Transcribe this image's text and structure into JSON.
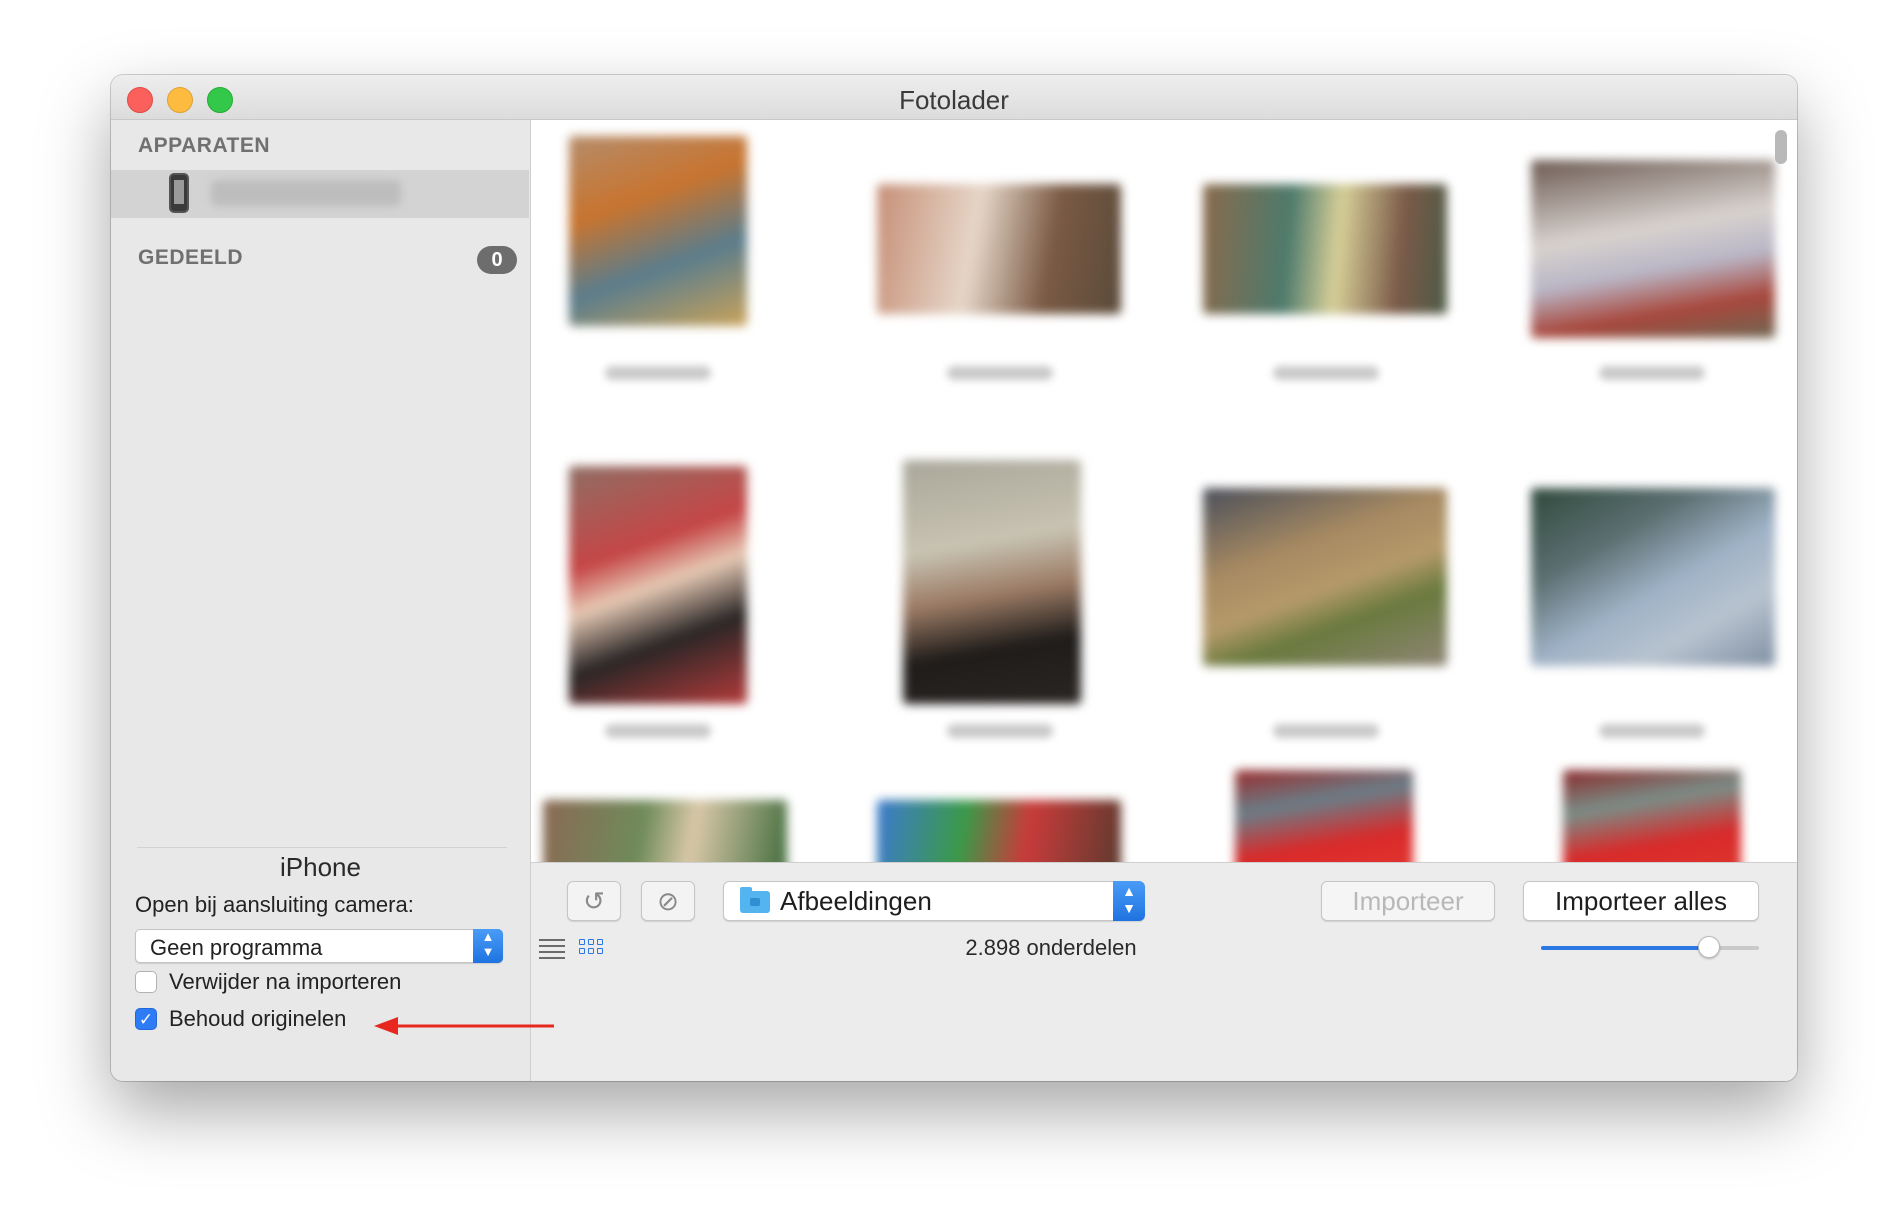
{
  "window": {
    "title": "Fotolader"
  },
  "sidebar": {
    "devices_heading": "APPARATEN",
    "shared_heading": "GEDEELD",
    "shared_count": "0"
  },
  "device_panel": {
    "name": "iPhone",
    "open_label": "Open bij aansluiting camera:",
    "open_select_value": "Geen programma",
    "delete_after_import": {
      "label": "Verwijder na importeren",
      "checked": false
    },
    "keep_originals": {
      "label": "Behoud originelen",
      "checked": true
    }
  },
  "toolbar": {
    "destination": "Afbeeldingen",
    "import_label": "Importeer",
    "import_all_label": "Importeer alles",
    "item_count": "2.898 onderdelen",
    "thumbnail_size_fraction": 0.77
  },
  "colors": {
    "accent": "#2b78e4",
    "annotation_arrow": "#e8281e"
  },
  "icons": [
    "iphone-icon",
    "rotate-icon",
    "delete-icon",
    "folder-icon",
    "list-view-icon",
    "grid-view-icon",
    "disclosure-icon"
  ]
}
